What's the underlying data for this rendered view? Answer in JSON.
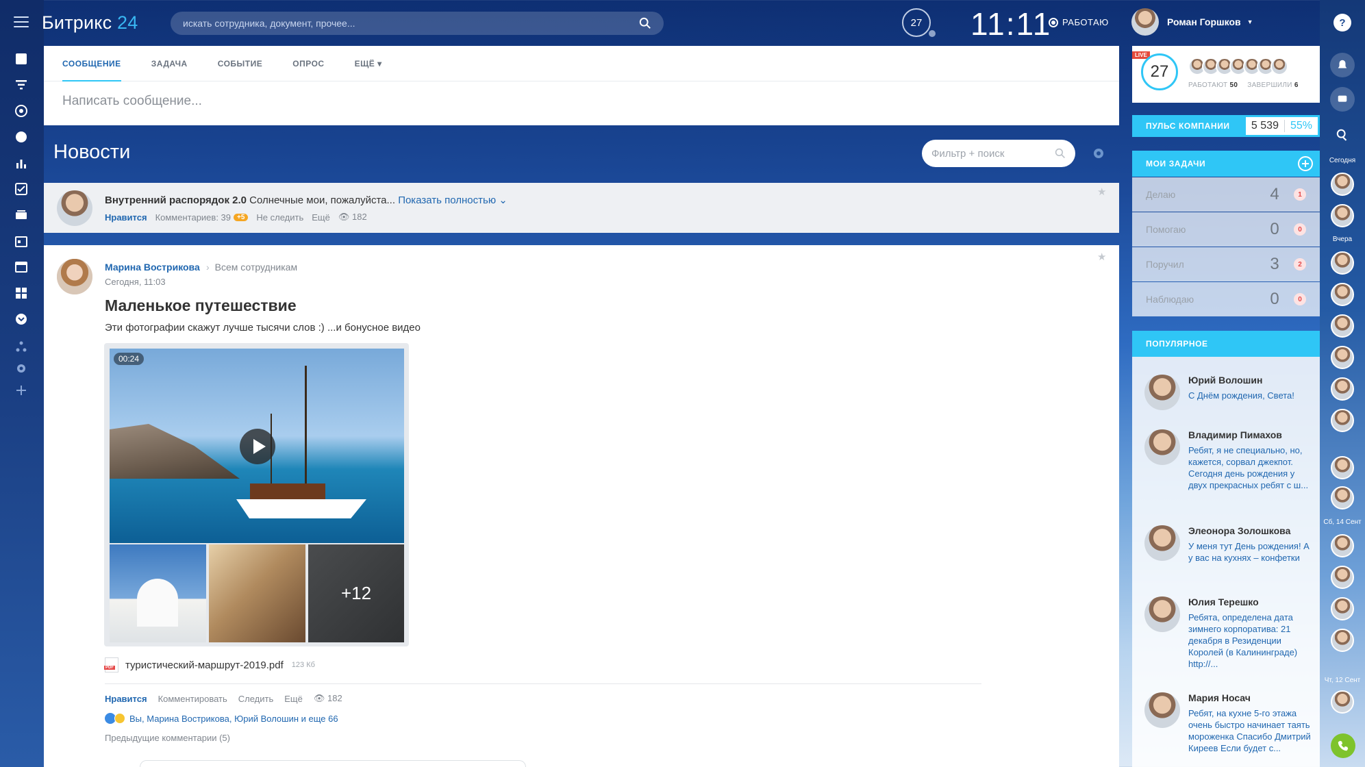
{
  "header": {
    "logo_text": "Битрикс",
    "logo_num": "24",
    "search_placeholder": "искать сотрудника, документ, прочее...",
    "timer_count": "27",
    "clock": "11:11",
    "work_status": "РАБОТАЮ",
    "user_name": "Роман Горшков"
  },
  "composer": {
    "tabs": [
      "СООБЩЕНИЕ",
      "ЗАДАЧА",
      "СОБЫТИЕ",
      "ОПРОС",
      "ЕЩЁ ▾"
    ],
    "placeholder": "Написать сообщение..."
  },
  "news": {
    "title": "Новости",
    "filter_placeholder": "Фильтр + поиск"
  },
  "pinned": {
    "title": "Внутренний распорядок 2.0",
    "text": "Солнечные мои, пожалуйста...",
    "show_more": "Показать полностью",
    "like": "Нравится",
    "comments": "Комментариев: 39",
    "new_comments": "+5",
    "unfollow": "Не следить",
    "more": "Ещё",
    "views": "182"
  },
  "post": {
    "author": "Марина Вострикова",
    "destination": "Всем сотрудникам",
    "date": "Сегодня, 11:03",
    "title": "Маленькое путешествие",
    "text": "Эти фотографии скажут лучше тысячи слов :) ...и бонусное видео",
    "video_duration": "00:24",
    "more_photos": "+12",
    "file_name": "туристический-маршрут-2019.pdf",
    "file_size": "123 Кб",
    "like": "Нравится",
    "comment": "Комментировать",
    "follow": "Следить",
    "more": "Ещё",
    "views": "182",
    "reactions_text": "Вы, Марина Вострикова, Юрий Волошин и еще 66",
    "previous_comments": "Предыдущие комментарии (5)"
  },
  "online": {
    "live": "LIVE",
    "count": "27",
    "working_label": "РАБОТАЮТ",
    "working_count": "50",
    "finished_label": "ЗАВЕРШИЛИ",
    "finished_count": "6"
  },
  "pulse": {
    "label": "ПУЛЬС КОМПАНИИ",
    "value": "5 539",
    "percent": "55%"
  },
  "tasks": {
    "title": "МОИ ЗАДАЧИ",
    "rows": [
      {
        "label": "Делаю",
        "count": "4",
        "badge": "1"
      },
      {
        "label": "Помогаю",
        "count": "0",
        "badge": "0"
      },
      {
        "label": "Поручил",
        "count": "3",
        "badge": "2"
      },
      {
        "label": "Наблюдаю",
        "count": "0",
        "badge": "0"
      }
    ]
  },
  "popular": {
    "title": "ПОПУЛЯРНОЕ",
    "items": [
      {
        "name": "Юрий Волошин",
        "msg": "С Днём рождения, Света!"
      },
      {
        "name": "Владимир Пимахов",
        "msg": "Ребят, я не специально, но, кажется, сорвал джекпот. Сегодня день рождения у двух прекрасных ребят с ш..."
      },
      {
        "name": "Элеонора Золошкова",
        "msg": "У меня тут День рождения! А у вас на кухнях – конфетки"
      },
      {
        "name": "Юлия Терешко",
        "msg": "Ребята, определена дата зимнего корпоратива: 21 декабря в Резиденции Королей (в Калининграде) http://..."
      },
      {
        "name": "Мария Носач",
        "msg": "Ребят, на кухне 5-го этажа очень быстро начинает таять мороженка Спасибо Дмитрий Киреев Если будет с..."
      }
    ]
  },
  "right_strip": {
    "today": "Сегодня",
    "yesterday": "Вчера",
    "date1": "Сб, 14 Сент",
    "date2": "Чт, 12 Сент"
  },
  "colors": {
    "accent": "#2fc6f6",
    "link": "#2067b0",
    "header_bg": "#0e2f73"
  }
}
